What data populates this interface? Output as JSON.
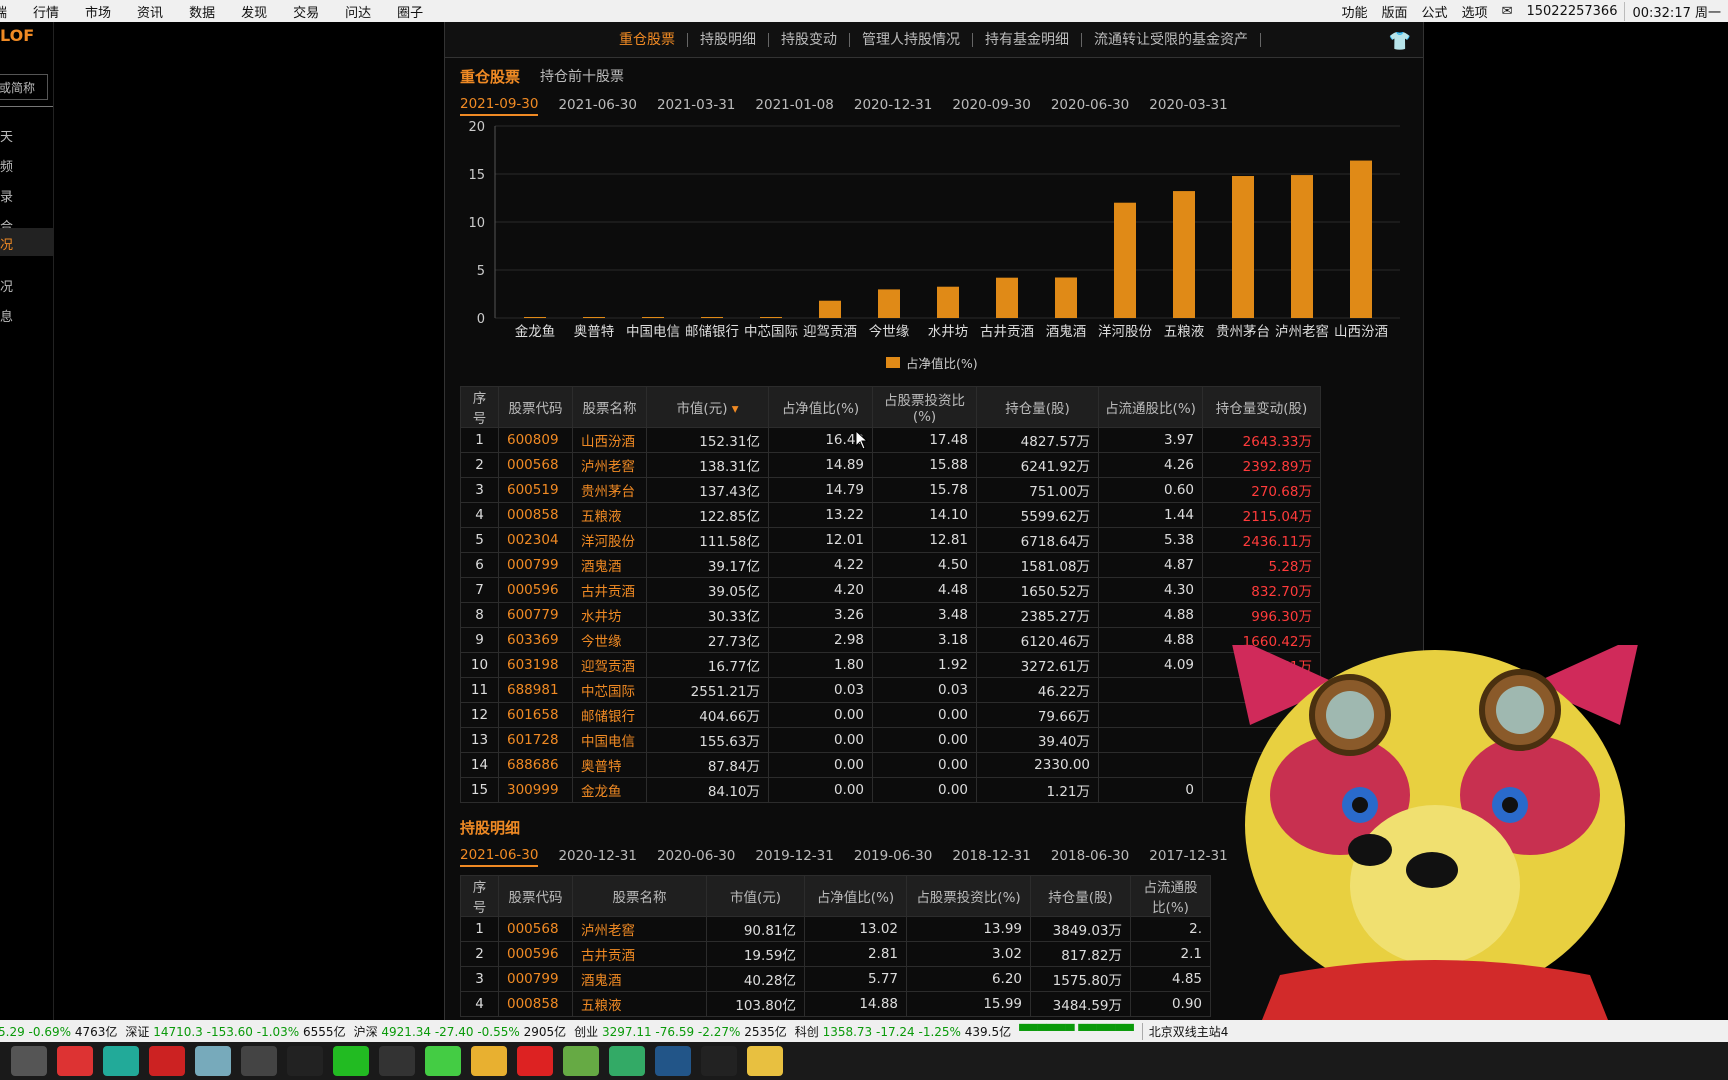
{
  "menubar": {
    "items": [
      "端",
      "行情",
      "市场",
      "资讯",
      "数据",
      "发现",
      "交易",
      "问达",
      "圈子"
    ],
    "right_items": [
      "功能",
      "版面",
      "公式",
      "选项"
    ],
    "phone": "15022257366",
    "clock": "00:32:17 周一"
  },
  "left_panel": {
    "code": "LOF",
    "search_placeholder": "或简称",
    "nav": [
      "天",
      "频",
      "录",
      "合",
      "况",
      "况",
      "息"
    ]
  },
  "tabs": [
    "重仓股票",
    "持股明细",
    "持股变动",
    "管理人持股情况",
    "持有基金明细",
    "流通转让受限的基金资产"
  ],
  "top_section": {
    "title": "重仓股票",
    "subtitle": "持仓前十股票",
    "dates": [
      "2021-09-30",
      "2021-06-30",
      "2021-03-31",
      "2021-01-08",
      "2020-12-31",
      "2020-09-30",
      "2020-06-30",
      "2020-03-31"
    ]
  },
  "chart_data": {
    "type": "bar",
    "categories": [
      "金龙鱼",
      "奥普特",
      "中国电信",
      "邮储银行",
      "中芯国际",
      "迎驾贡酒",
      "今世缘",
      "水井坊",
      "古井贡酒",
      "酒鬼酒",
      "洋河股份",
      "五粮液",
      "贵州茅台",
      "泸州老窖",
      "山西汾酒"
    ],
    "values": [
      0.0,
      0.0,
      0.0,
      0.0,
      0.03,
      1.8,
      2.98,
      3.26,
      4.2,
      4.22,
      12.01,
      13.22,
      14.79,
      14.89,
      16.4
    ],
    "legend": "占净值比(%)",
    "y_ticks": [
      0,
      5,
      10,
      15,
      20
    ],
    "ylim": [
      0,
      20
    ],
    "bar_color": "#e08a17"
  },
  "table1": {
    "headers": [
      "序号",
      "股票代码",
      "股票名称",
      "市值(元)",
      "占净值比(%)",
      "占股票投资比(%)",
      "持仓量(股)",
      "占流通股比(%)",
      "持仓量变动(股)"
    ],
    "rows": [
      [
        "1",
        "600809",
        "山西汾酒",
        "152.31亿",
        "16.40",
        "17.48",
        "4827.57万",
        "3.97",
        "2643.33万"
      ],
      [
        "2",
        "000568",
        "泸州老窖",
        "138.31亿",
        "14.89",
        "15.88",
        "6241.92万",
        "4.26",
        "2392.89万"
      ],
      [
        "3",
        "600519",
        "贵州茅台",
        "137.43亿",
        "14.79",
        "15.78",
        "751.00万",
        "0.60",
        "270.68万"
      ],
      [
        "4",
        "000858",
        "五粮液",
        "122.85亿",
        "13.22",
        "14.10",
        "5599.62万",
        "1.44",
        "2115.04万"
      ],
      [
        "5",
        "002304",
        "洋河股份",
        "111.58亿",
        "12.01",
        "12.81",
        "6718.64万",
        "5.38",
        "2436.11万"
      ],
      [
        "6",
        "000799",
        "酒鬼酒",
        "39.17亿",
        "4.22",
        "4.50",
        "1581.08万",
        "4.87",
        "5.28万"
      ],
      [
        "7",
        "000596",
        "古井贡酒",
        "39.05亿",
        "4.20",
        "4.48",
        "1650.52万",
        "4.30",
        "832.70万"
      ],
      [
        "8",
        "600779",
        "水井坊",
        "30.33亿",
        "3.26",
        "3.48",
        "2385.27万",
        "4.88",
        "996.30万"
      ],
      [
        "9",
        "603369",
        "今世缘",
        "27.73亿",
        "2.98",
        "3.18",
        "6120.46万",
        "4.88",
        "1660.42万"
      ],
      [
        "10",
        "603198",
        "迎驾贡酒",
        "16.77亿",
        "1.80",
        "1.92",
        "3272.61万",
        "4.09",
        "3272.61万"
      ],
      [
        "11",
        "688981",
        "中芯国际",
        "2551.21万",
        "0.03",
        "0.03",
        "46.22万",
        "",
        ""
      ],
      [
        "12",
        "601658",
        "邮储银行",
        "404.66万",
        "0.00",
        "0.00",
        "79.66万",
        "",
        ""
      ],
      [
        "13",
        "601728",
        "中国电信",
        "155.63万",
        "0.00",
        "0.00",
        "39.40万",
        "",
        ""
      ],
      [
        "14",
        "688686",
        "奥普特",
        "87.84万",
        "0.00",
        "0.00",
        "2330.00",
        "",
        ""
      ],
      [
        "15",
        "300999",
        "金龙鱼",
        "84.10万",
        "0.00",
        "0.00",
        "1.21万",
        "0",
        ""
      ]
    ]
  },
  "bottom_section": {
    "title": "持股明细",
    "dates": [
      "2021-06-30",
      "2020-12-31",
      "2020-06-30",
      "2019-12-31",
      "2019-06-30",
      "2018-12-31",
      "2018-06-30",
      "2017-12-31"
    ]
  },
  "table2": {
    "headers": [
      "序号",
      "股票代码",
      "股票名称",
      "市值(元)",
      "占净值比(%)",
      "占股票投资比(%)",
      "持仓量(股)",
      "占流通股比(%)"
    ],
    "rows": [
      [
        "1",
        "000568",
        "泸州老窖",
        "90.81亿",
        "13.02",
        "13.99",
        "3849.03万",
        "2."
      ],
      [
        "2",
        "000596",
        "古井贡酒",
        "19.59亿",
        "2.81",
        "3.02",
        "817.82万",
        "2.1"
      ],
      [
        "3",
        "000799",
        "酒鬼酒",
        "40.28亿",
        "5.77",
        "6.20",
        "1575.80万",
        "4.85"
      ],
      [
        "4",
        "000858",
        "五粮液",
        "103.80亿",
        "14.88",
        "15.99",
        "3484.59万",
        "0.90"
      ]
    ]
  },
  "statusbar": {
    "segments": [
      {
        "label": "",
        "value": "5.29",
        "chg": "-0.69%",
        "amt": "4763亿"
      },
      {
        "label": "深证",
        "value": "14710.3",
        "chg": "-153.60 -1.03%",
        "amt": "6555亿"
      },
      {
        "label": "沪深",
        "value": "4921.34",
        "chg": "-27.40 -0.55%",
        "amt": "2905亿"
      },
      {
        "label": "创业",
        "value": "3297.11",
        "chg": "-76.59 -2.27%",
        "amt": "2535亿"
      },
      {
        "label": "科创",
        "value": "1358.73",
        "chg": "-17.24 -1.25%",
        "amt": "439.5亿"
      }
    ],
    "server": "北京双线主站4"
  },
  "taskbar": {
    "apps": [
      "task-view",
      "netease-music",
      "mindmaster",
      "stock-app",
      "settings",
      "obs",
      "capcut",
      "wechat",
      "qq",
      "browser",
      "explorer",
      "wps",
      "game",
      "security",
      "camera",
      "capcut2",
      "tdx"
    ],
    "colors": [
      "#555",
      "#d33",
      "#2a9",
      "#c22",
      "#7ab",
      "#444",
      "#222",
      "#2b2",
      "#333",
      "#4c4",
      "#e8b030",
      "#d22",
      "#6a4",
      "#3a6",
      "#258",
      "#222",
      "#e8c040"
    ]
  }
}
